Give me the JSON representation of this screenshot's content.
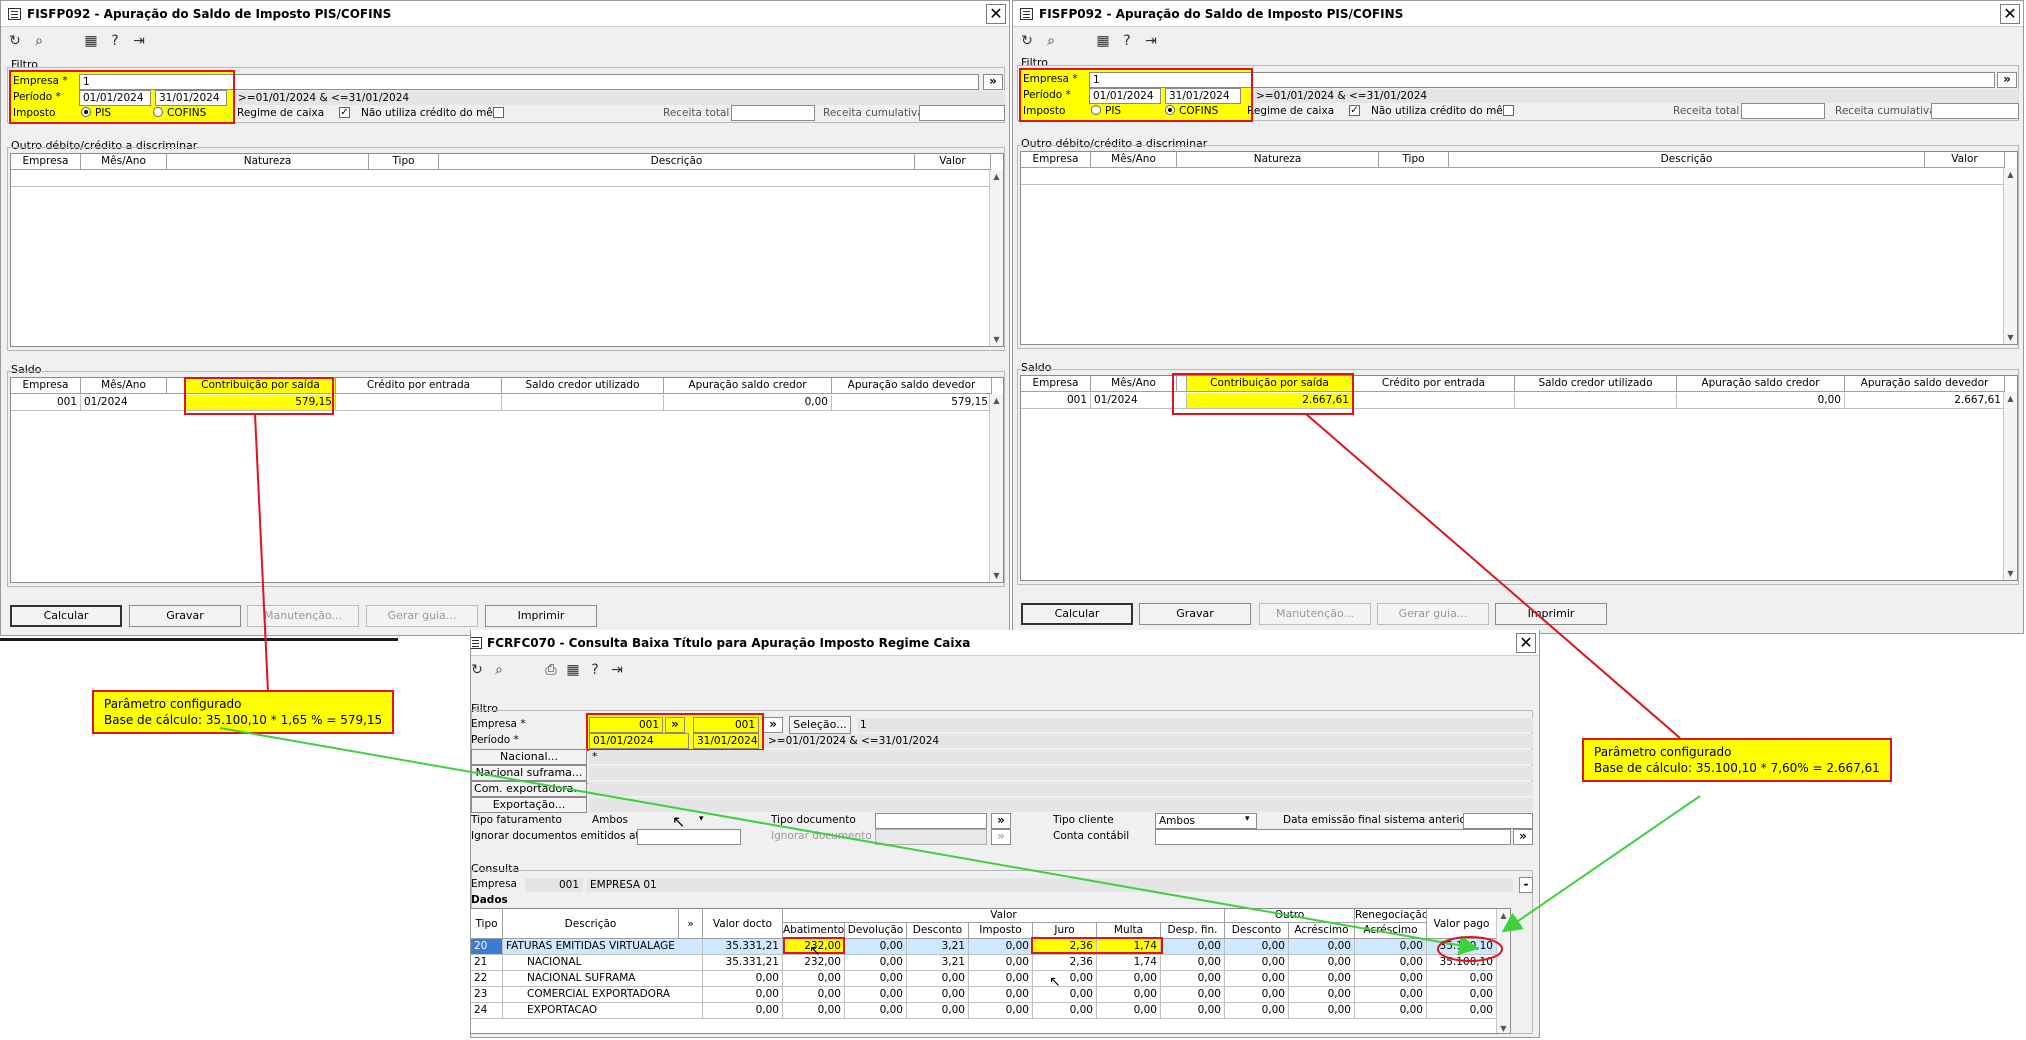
{
  "win1": {
    "title": "FISFP092 - Apuração do Saldo de Imposto PIS/COFINS",
    "close": "✕",
    "filtro_label": "Filtro",
    "empresa_label": "Empresa *",
    "empresa_value": "1",
    "periodo_label": "Período *",
    "periodo_ini": "01/01/2024",
    "periodo_fim": "31/01/2024",
    "periodo_expr": ">=01/01/2024 & <=31/01/2024",
    "imposto_label": "Imposto",
    "imposto_opt1": "PIS",
    "imposto_opt2": "COFINS",
    "imposto_selected": "PIS",
    "regime_label": "Regime de caixa",
    "nao_utiliza_label": "Não utiliza crédito do mês",
    "receita_total_label": "Receita total",
    "receita_cumulativa_label": "Receita cumulativa",
    "outro_label": "Outro débito/crédito a discriminar",
    "outro_headers": [
      "Empresa",
      "Mês/Ano",
      "Natureza",
      "Tipo",
      "Descrição",
      "Valor"
    ],
    "saldo_label": "Saldo",
    "saldo_headers": [
      "Empresa",
      "Mês/Ano",
      "Contribuição por saída",
      "Crédito por entrada",
      "Saldo credor utilizado",
      "Apuração saldo credor",
      "Apuração saldo devedor"
    ],
    "saldo_row": [
      "001",
      "01/2024",
      "579,15",
      "",
      "",
      "0,00",
      "579,15"
    ],
    "buttons": [
      "Calcular",
      "Gravar",
      "Manutenção...",
      "Gerar guia...",
      "Imprimir"
    ]
  },
  "win2": {
    "title": "FISFP092 - Apuração do Saldo de Imposto PIS/COFINS",
    "close": "✕",
    "filtro_label": "Filtro",
    "empresa_label": "Empresa *",
    "empresa_value": "1",
    "periodo_label": "Período *",
    "periodo_ini": "01/01/2024",
    "periodo_fim": "31/01/2024",
    "periodo_expr": ">=01/01/2024 & <=31/01/2024",
    "imposto_label": "Imposto",
    "imposto_opt1": "PIS",
    "imposto_opt2": "COFINS",
    "imposto_selected": "COFINS",
    "regime_label": "Regime de caixa",
    "nao_utiliza_label": "Não utiliza crédito do mês",
    "receita_total_label": "Receita total",
    "receita_cumulativa_label": "Receita cumulativa",
    "outro_label": "Outro débito/crédito a discriminar",
    "outro_headers": [
      "Empresa",
      "Mês/Ano",
      "Natureza",
      "Tipo",
      "Descrição",
      "Valor"
    ],
    "saldo_label": "Saldo",
    "saldo_headers": [
      "Empresa",
      "Mês/Ano",
      "Contribuição por saída",
      "Crédito por entrada",
      "Saldo credor utilizado",
      "Apuração saldo credor",
      "Apuração saldo devedor"
    ],
    "saldo_row": [
      "001",
      "01/2024",
      "2.667,61",
      "",
      "",
      "0,00",
      "2.667,61"
    ],
    "buttons": [
      "Calcular",
      "Gravar",
      "Manutenção...",
      "Gerar guia...",
      "Imprimir"
    ]
  },
  "win3": {
    "title": "FCRFC070 - Consulta Baixa Título para Apuração Imposto Regime Caixa",
    "close": "✕",
    "filtro_label": "Filtro",
    "empresa_label": "Empresa *",
    "empresa_ini": "001",
    "empresa_fim": "001",
    "selecao_button": "Seleção...",
    "selecao_value": "1",
    "periodo_label": "Período *",
    "periodo_ini": "01/01/2024",
    "periodo_fim": "31/01/2024",
    "periodo_expr": ">=01/01/2024 & <=31/01/2024",
    "side_buttons": [
      "Nacional...",
      "Nacional suframa...",
      "Com. exportadora...",
      "Exportação..."
    ],
    "nacional_value": "*",
    "tipo_fat_label": "Tipo faturamento",
    "tipo_fat_value": "Ambos",
    "tipo_doc_label": "Tipo documento",
    "tipo_cliente_label": "Tipo cliente",
    "tipo_cliente_value": "Ambos",
    "data_emissao_label": "Data emissão final sistema anterior",
    "ignorar_label": "Ignorar documentos emitidos até",
    "ignorar_doc_label": "Ignorar documento",
    "conta_contabil_label": "Conta contábil",
    "consulta_label": "Consulta",
    "consulta_empresa_label": "Empresa",
    "consulta_empresa_code": "001",
    "consulta_empresa_name": "EMPRESA 01",
    "dados_label": "Dados",
    "group_headers": [
      "Valor",
      "Outro",
      "Renegociação"
    ],
    "col_headers": [
      "Tipo",
      "Descrição",
      "»",
      "Valor docto",
      "Abatimento",
      "Devolução",
      "Desconto",
      "Imposto",
      "Juro",
      "Multa",
      "Desp. fin.",
      "Desconto",
      "Acréscimo",
      "Acréscimo",
      "Valor pago"
    ],
    "rows": [
      [
        "20",
        "FATURAS EMITIDAS VIRTUALAGE",
        "35.331,21",
        "232,00",
        "0,00",
        "3,21",
        "0,00",
        "2,36",
        "1,74",
        "0,00",
        "0,00",
        "0,00",
        "0,00",
        "35.100,10"
      ],
      [
        "21",
        "NACIONAL",
        "35.331,21",
        "232,00",
        "0,00",
        "3,21",
        "0,00",
        "2,36",
        "1,74",
        "0,00",
        "0,00",
        "0,00",
        "0,00",
        "35.100,10"
      ],
      [
        "22",
        "NACIONAL SUFRAMA",
        "0,00",
        "0,00",
        "0,00",
        "0,00",
        "0,00",
        "0,00",
        "0,00",
        "0,00",
        "0,00",
        "0,00",
        "0,00",
        "0,00"
      ],
      [
        "23",
        "COMERCIAL EXPORTADORA",
        "0,00",
        "0,00",
        "0,00",
        "0,00",
        "0,00",
        "0,00",
        "0,00",
        "0,00",
        "0,00",
        "0,00",
        "0,00",
        "0,00"
      ],
      [
        "24",
        "EXPORTACAO",
        "0,00",
        "0,00",
        "0,00",
        "0,00",
        "0,00",
        "0,00",
        "0,00",
        "0,00",
        "0,00",
        "0,00",
        "0,00",
        "0,00"
      ]
    ]
  },
  "note_pis": {
    "line1": "Parâmetro  configurado",
    "line2": "Base de cálculo: 35.100,10 * 1,65 % = 579,15"
  },
  "note_cofins": {
    "line1": "Parâmetro  configurado",
    "line2": "Base de cálculo: 35.100,10 * 7,60% = 2.667,61"
  },
  "colors": {
    "highlight_border": "#e0141e",
    "highlight_fill": "#ffff00",
    "arrow_red": "#e0141e",
    "arrow_green": "#3ed13e"
  }
}
